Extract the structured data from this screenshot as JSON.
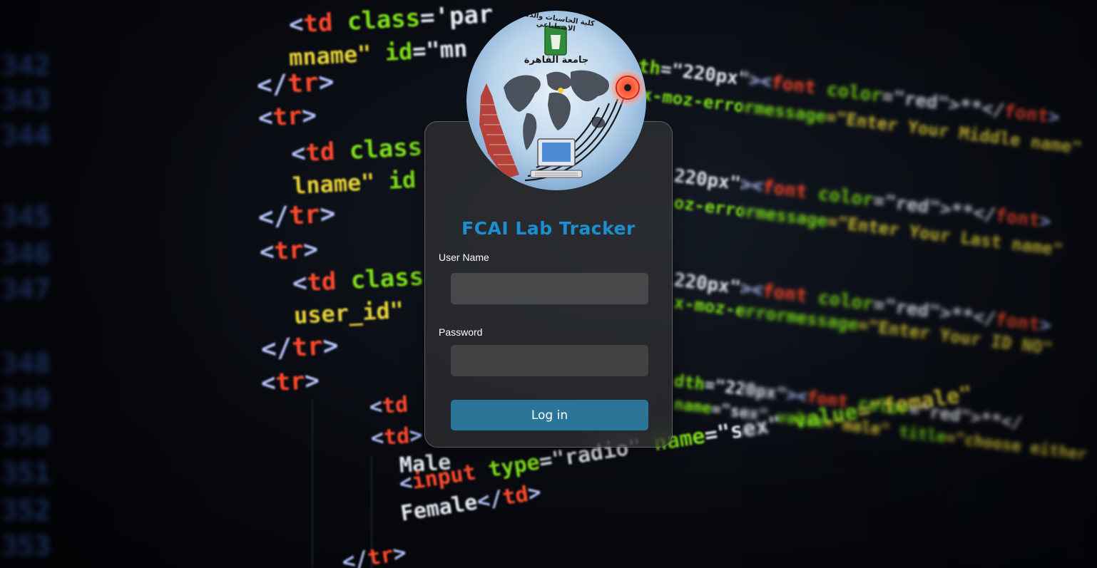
{
  "background": {
    "line_numbers": [
      "342",
      "343",
      "344",
      "345",
      "346",
      "347",
      "348",
      "349",
      "350",
      "351",
      "352",
      "353"
    ],
    "code_lines": [
      {
        "tokens": [
          [
            "<",
            "lblue"
          ],
          [
            "td ",
            "red"
          ],
          [
            "class",
            "green"
          ],
          [
            "='par",
            "white"
          ]
        ]
      },
      {
        "tokens": [
          [
            "mname\" ",
            "yellow"
          ],
          [
            "id",
            "green"
          ],
          [
            "=\"mn",
            "white"
          ]
        ]
      },
      {
        "tokens": [
          [
            "</",
            "lblue"
          ],
          [
            "tr",
            "red"
          ],
          [
            ">",
            "lblue"
          ]
        ]
      },
      {
        "tokens": [
          [
            "<",
            "lblue"
          ],
          [
            "tr",
            "red"
          ],
          [
            ">",
            "lblue"
          ]
        ]
      },
      {
        "tokens": [
          [
            "<",
            "lblue"
          ],
          [
            "td ",
            "red"
          ],
          [
            "class",
            "green"
          ]
        ]
      },
      {
        "tokens": [
          [
            "lname\" ",
            "yellow"
          ],
          [
            "id",
            "green"
          ]
        ]
      },
      {
        "tokens": [
          [
            "</",
            "lblue"
          ],
          [
            "tr",
            "red"
          ],
          [
            ">",
            "lblue"
          ]
        ]
      },
      {
        "tokens": [
          [
            "<",
            "lblue"
          ],
          [
            "tr",
            "red"
          ],
          [
            ">",
            "lblue"
          ]
        ]
      },
      {
        "tokens": [
          [
            "<",
            "lblue"
          ],
          [
            "td ",
            "red"
          ],
          [
            "class",
            "green"
          ]
        ]
      },
      {
        "tokens": [
          [
            "user_id\"",
            "yellow"
          ]
        ]
      },
      {
        "tokens": [
          [
            "</",
            "lblue"
          ],
          [
            "tr",
            "red"
          ],
          [
            ">",
            "lblue"
          ]
        ]
      },
      {
        "tokens": [
          [
            "<",
            "lblue"
          ],
          [
            "tr",
            "red"
          ],
          [
            ">",
            "lblue"
          ]
        ]
      },
      {
        "tokens": [
          [
            "<",
            "lblue"
          ],
          [
            "td",
            "red"
          ]
        ]
      },
      {
        "tokens": [
          [
            "<",
            "lblue"
          ],
          [
            "td",
            "red"
          ],
          [
            ">",
            "lblue"
          ]
        ]
      },
      {
        "tokens": [
          [
            "Male",
            "white"
          ]
        ]
      },
      {
        "tokens": [
          [
            "<",
            "lblue"
          ],
          [
            "input ",
            "red"
          ],
          [
            "type",
            "green"
          ],
          [
            "=\"radio\" ",
            "white"
          ],
          [
            "name",
            "green"
          ],
          [
            "=\"sex\" ",
            "white"
          ],
          [
            "value",
            "green"
          ],
          [
            "=\"female\"",
            "yellow"
          ]
        ]
      },
      {
        "tokens": [
          [
            "Female",
            "white"
          ],
          [
            "</",
            "lblue"
          ],
          [
            "td",
            "red"
          ],
          [
            ">",
            "lblue"
          ]
        ]
      },
      {
        "tokens": [
          [
            "</",
            "lblue"
          ],
          [
            "tr",
            "red"
          ],
          [
            ">",
            "lblue"
          ]
        ]
      }
    ],
    "right_code_lines": [
      {
        "tokens": [
          [
            "th",
            "green"
          ],
          [
            "=\"220px\"",
            "white"
          ],
          [
            "><",
            "lblue"
          ],
          [
            "font ",
            "red"
          ],
          [
            "color",
            "green"
          ],
          [
            "=\"red\"",
            ""
          ],
          [
            ">**</",
            "white"
          ],
          [
            "font",
            "red"
          ],
          [
            ">",
            "lblue"
          ]
        ]
      },
      {
        "tokens": [
          [
            "x-moz-errormessage",
            "green"
          ],
          [
            "=\"Enter Your Middle name\"",
            "yellow"
          ]
        ]
      },
      {
        "tokens": [
          [
            "220px\"",
            "white"
          ],
          [
            "><",
            "lblue"
          ],
          [
            "font ",
            "red"
          ],
          [
            "color",
            "green"
          ],
          [
            "=\"red\"",
            "white"
          ],
          [
            ">**</",
            "white"
          ],
          [
            "font",
            "red"
          ],
          [
            ">",
            "lblue"
          ]
        ]
      },
      {
        "tokens": [
          [
            "oz-errormessage",
            "green"
          ],
          [
            "=\"Enter Your Last name\"",
            "yellow"
          ]
        ]
      },
      {
        "tokens": [
          [
            "220px\"",
            "white"
          ],
          [
            "><",
            "lblue"
          ],
          [
            "font ",
            "red"
          ],
          [
            "color",
            "green"
          ],
          [
            "=\"red\"",
            "white"
          ],
          [
            ">**</",
            "white"
          ],
          [
            "font",
            "red"
          ],
          [
            ">",
            "lblue"
          ]
        ]
      },
      {
        "tokens": [
          [
            "x-moz-errormessage",
            "green"
          ],
          [
            "=\"Enter Your ID NO\"",
            "yellow"
          ]
        ]
      },
      {
        "tokens": [
          [
            "dth",
            "green"
          ],
          [
            "=\"220px\"",
            "white"
          ],
          [
            "><",
            "lblue"
          ],
          [
            "font ",
            "red"
          ],
          [
            "color",
            "green"
          ],
          [
            "=\"red\"",
            "white"
          ],
          [
            ">**</",
            "white"
          ]
        ]
      },
      {
        "tokens": [
          [
            "name",
            "green"
          ],
          [
            "=\"sex\" ",
            "white"
          ],
          [
            "value",
            "green"
          ],
          [
            "=\"male\" ",
            "yellow"
          ],
          [
            "title",
            "green"
          ],
          [
            "=\"choose either male or female\"",
            "yellow"
          ]
        ]
      }
    ]
  },
  "logo": {
    "arabic_top": "كلية الحاسبات والذكاء الاصطناعي",
    "arabic_university": "جامعة القاهرة"
  },
  "form": {
    "title": "FCAI Lab Tracker",
    "username_label": "User Name",
    "username_value": "",
    "password_label": "Password",
    "password_value": "",
    "login_label": "Log in"
  },
  "colors": {
    "title": "#1c8fd0",
    "button": "#2a7598"
  }
}
